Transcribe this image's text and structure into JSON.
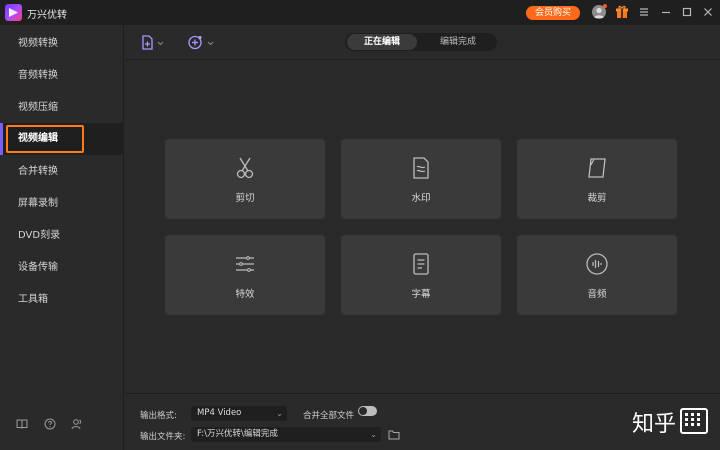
{
  "app": {
    "title": "万兴优转",
    "buy_label": "会员购买"
  },
  "sidebar": {
    "items": [
      {
        "label": "视频转换"
      },
      {
        "label": "音频转换"
      },
      {
        "label": "视频压缩"
      },
      {
        "label": "视频编辑"
      },
      {
        "label": "合并转换"
      },
      {
        "label": "屏幕录制"
      },
      {
        "label": "DVD刻录"
      },
      {
        "label": "设备传输"
      },
      {
        "label": "工具箱"
      }
    ],
    "active_index": 3
  },
  "tabs": {
    "active": "正在编辑",
    "idle": "编辑完成"
  },
  "tools": [
    {
      "label": "剪切",
      "icon": "scissors-icon"
    },
    {
      "label": "水印",
      "icon": "watermark-icon"
    },
    {
      "label": "裁剪",
      "icon": "crop-icon"
    },
    {
      "label": "特效",
      "icon": "effects-icon"
    },
    {
      "label": "字幕",
      "icon": "subtitle-icon"
    },
    {
      "label": "音频",
      "icon": "audio-icon"
    }
  ],
  "footer": {
    "format_label": "输出格式:",
    "format_value": "MP4 Video",
    "merge_label": "合并全部文件",
    "folder_label": "输出文件夹:",
    "folder_value": "F:\\万兴优转\\编辑完成"
  },
  "watermark": {
    "text": "知乎"
  },
  "colors": {
    "accent": "#ff6a1a",
    "highlight": "#ff7a1a",
    "brand": "#7a5cff"
  }
}
